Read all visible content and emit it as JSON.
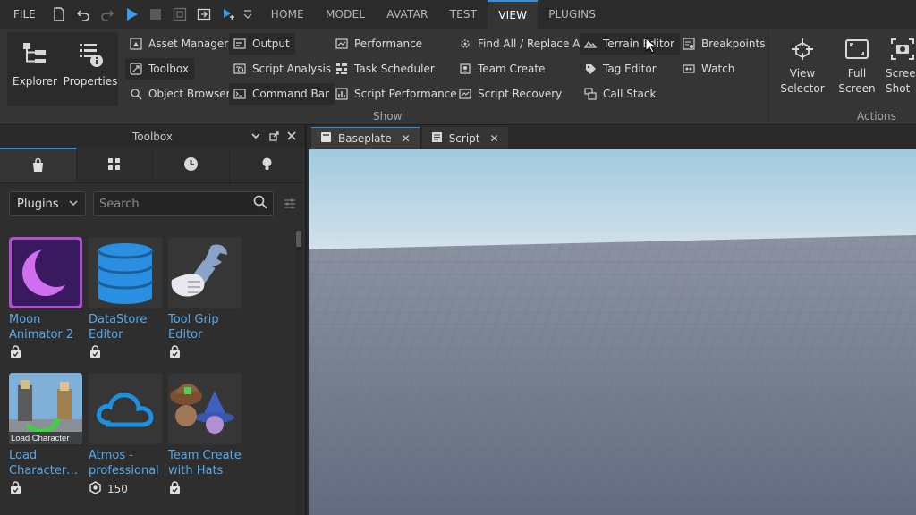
{
  "menubar": {
    "file_label": "FILE",
    "tabs": [
      {
        "label": "HOME"
      },
      {
        "label": "MODEL"
      },
      {
        "label": "AVATAR"
      },
      {
        "label": "TEST"
      },
      {
        "label": "VIEW",
        "active": true
      },
      {
        "label": "PLUGINS"
      }
    ]
  },
  "ribbon": {
    "explorer_label": "Explorer",
    "properties_label": "Properties",
    "show": {
      "col1": [
        "Asset Manager",
        "Toolbox",
        "Object Browser"
      ],
      "col2": [
        "Output",
        "Script Analysis",
        "Command Bar"
      ],
      "col3": [
        "Performance",
        "Task Scheduler",
        "Script Performance"
      ],
      "col4": [
        "Find All / Replace All",
        "Team Create",
        "Script Recovery"
      ],
      "col5": [
        "Terrain Editor",
        "Tag Editor",
        "Call Stack"
      ],
      "col6": [
        "Breakpoints",
        "Watch"
      ],
      "group_label": "Show"
    },
    "actions": {
      "view_selector": [
        "View",
        "Selector"
      ],
      "full_screen": [
        "Full",
        "Screen"
      ],
      "screenshot": [
        "Screen",
        "Shot"
      ],
      "group_label": "Actions"
    }
  },
  "toolbox": {
    "title": "Toolbox",
    "category": "Plugins",
    "search_placeholder": "Search",
    "items": [
      {
        "name": "Moon Animator 2",
        "meta": ""
      },
      {
        "name": "DataStore Editor",
        "meta": ""
      },
      {
        "name": "Tool Grip Editor",
        "meta": ""
      },
      {
        "name": "Load Character…",
        "meta": "",
        "thumb_caption": "Load Character"
      },
      {
        "name": "Atmos - professional",
        "meta": "150"
      },
      {
        "name": "Team Create with Hats",
        "meta": ""
      }
    ]
  },
  "doc_tabs": [
    {
      "label": "Baseplate",
      "active": true
    },
    {
      "label": "Script",
      "active": false
    }
  ],
  "colors": {
    "accent": "#3b8fd6",
    "link": "#58a8e8",
    "sky_top": "#9fc9df",
    "ground": "#6c7488"
  }
}
